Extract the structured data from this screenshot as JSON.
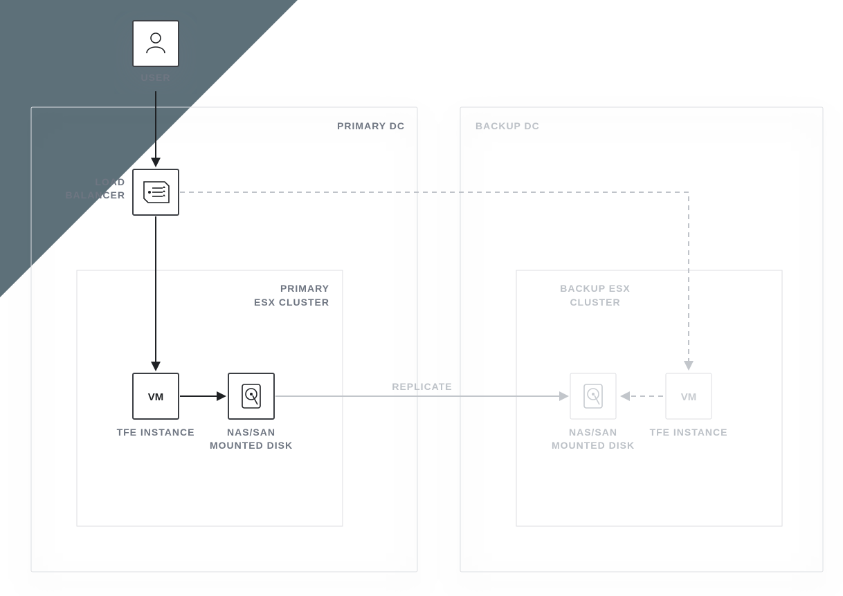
{
  "user": {
    "label": "USER"
  },
  "loadBalancer": {
    "label1": "LOAD",
    "label2": "BALANCER"
  },
  "primary": {
    "title": "PRIMARY DC",
    "cluster": {
      "title1": "PRIMARY",
      "title2": "ESX CLUSTER"
    },
    "vm": {
      "text": "VM",
      "label": "TFE INSTANCE"
    },
    "disk": {
      "label1": "NAS/SAN",
      "label2": "MOUNTED DISK"
    }
  },
  "backup": {
    "title": "BACKUP DC",
    "cluster": {
      "title1": "BACKUP ESX",
      "title2": "CLUSTER"
    },
    "vm": {
      "text": "VM",
      "label": "TFE INSTANCE"
    },
    "disk": {
      "label1": "NAS/SAN",
      "label2": "MOUNTED DISK"
    }
  },
  "replicate": {
    "label": "REPLICATE"
  }
}
